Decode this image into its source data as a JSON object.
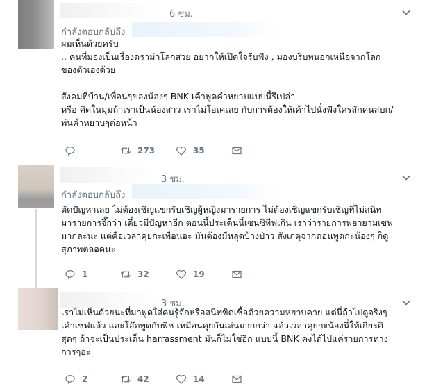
{
  "tweets": [
    {
      "time": "6 ชม.",
      "reply_label": "กำลังตอบกลับถึง",
      "body": "ผมเห็นด้วยครับ\n.. คนที่มองเป็นเรื่องดราม่าโลกสวย อยากให้เปิดใจรับฟัง , มองบริบทนอกเหนือจากโลก\nของตัวเองด้วย\n\nสังคมที่บ้าน/เพื่อนๆของน้องๆ BNK เค้าพูดคำหยาบแบบนี้รึเปล่า\nหรือ คิดในมุมถ้าเราเป็นน้องสาว เราไม่โอเคเลย กับการต้องให้เค้าไปนั่งฟังใครสักคนสบถ/\nพ่นคำหยาบๆต่อหน้า",
      "replies": "",
      "retweets": "273",
      "likes": "35"
    },
    {
      "time": "3 ชม.",
      "reply_label": "กำลังตอบกลับถึง",
      "body": "ตัดปัญหาเลย ไม่ต้องเชิญแขกรับเชิญผู้หญิงมารายการ ไม่ต้องเชิญแขกรับเชิญที่ไม่สนิท\nมารายการจึ๊กว่า เดี๋ยวมีปัญหาอีก ตอนนี้ประเด็นนี้เซนซิทีฟเกิน เราว่ารายการพยายามเซฟ\nมากละนะ แต่คือเวลาคุยกะเพื่อนอะ มันต้องมีหลุดบ้างป่าว สังเกตุจากตอนพูดกะน้องๆ ก็ดู\nสุภาพตลอดนะ",
      "replies": "1",
      "retweets": "32",
      "likes": "19"
    },
    {
      "time": "3 ชม.",
      "body": "เราไม่เห็นด้วยนะที่มาพูดใส่คนรู้จักหรือสนิทขิดเชื้อด้วยความหยาบคาย แต่นี่ถ้าไปดูจริงๆ\nเค้าเซฟแล้ว และโอ๊ตพูดกับพีช เหมือนคุยกันเล่นมากกว่า แล้วเวลาคุยกะน้องนี่ให้เกียรติ\nสุดๆ ถ้าจะเป็นประเด็น harrassment มันก็ไม่ใช่อีก แบบนี้ BNK คงได้ไปแค่รายการทาง\nการๆอะ",
      "replies": "2",
      "retweets": "42",
      "likes": "14"
    }
  ],
  "icons": {
    "reply": "reply-icon",
    "retweet": "retweet-icon",
    "like": "heart-icon",
    "message": "envelope-icon",
    "caret": "chevron-down-icon"
  },
  "colors": {
    "muted": "#657786",
    "link": "#1da1f2",
    "divider": "#e6ecf0"
  }
}
